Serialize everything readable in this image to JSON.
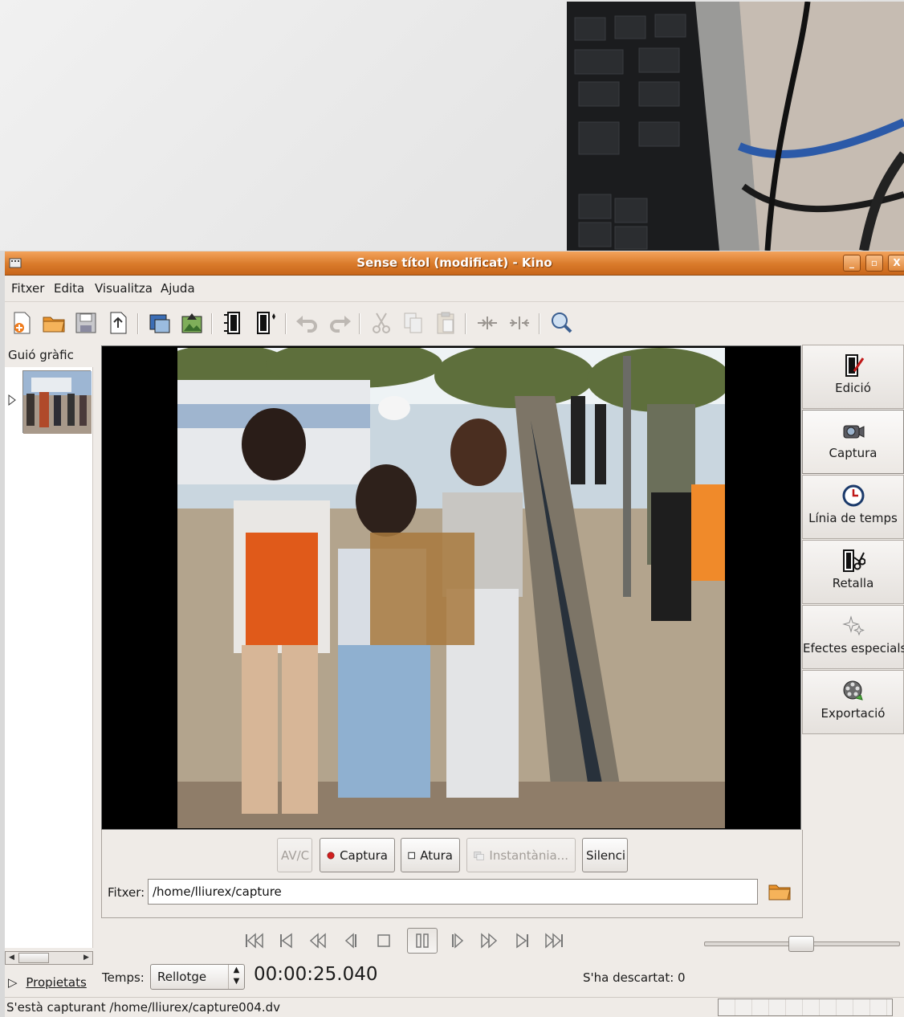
{
  "window": {
    "title": "Sense títol (modificat)  - Kino",
    "buttons": {
      "minimize": "_",
      "maximize": "▫",
      "close": "X"
    }
  },
  "menu": {
    "items": [
      {
        "label": "Fitxer"
      },
      {
        "label": "Edita"
      },
      {
        "label": "Visualitza"
      },
      {
        "label": "Ajuda"
      }
    ]
  },
  "toolbar": {
    "icons": [
      "new-document-icon",
      "open-folder-icon",
      "save-icon",
      "export-file-icon",
      "capture-frame-icon",
      "publish-icon",
      "insert-before-icon",
      "insert-after-icon",
      "undo-icon",
      "redo-icon",
      "cut-icon",
      "copy-icon",
      "paste-icon",
      "split-icon",
      "join-icon",
      "zoom-icon"
    ]
  },
  "storyboard": {
    "header": "Guió gràfic"
  },
  "properties": {
    "label": "Propietats"
  },
  "capture": {
    "avc_label": "AV/C",
    "capture_label": "Captura",
    "stop_label": "Atura",
    "snapshot_label": "Instantània...",
    "mute_label": "Silenci",
    "file_label": "Fitxer:",
    "file_value": "/home/lliurex/capture"
  },
  "sidebar": {
    "items": [
      {
        "label": "Edició",
        "icon": "edit-icon"
      },
      {
        "label": "Captura",
        "icon": "camera-icon"
      },
      {
        "label": "Línia de temps",
        "icon": "clock-icon"
      },
      {
        "label": "Retalla",
        "icon": "trim-icon"
      },
      {
        "label": "Efectes especials",
        "icon": "sparkle-icon"
      },
      {
        "label": "Exportació",
        "icon": "film-reel-icon"
      }
    ]
  },
  "transport": {
    "icons": [
      "skip-start-icon",
      "previous-scene-icon",
      "rewind-icon",
      "previous-frame-icon",
      "stop-icon",
      "pause-icon",
      "next-frame-icon",
      "fast-forward-icon",
      "next-scene-icon",
      "skip-end-icon"
    ]
  },
  "timebar": {
    "temps_label": "Temps:",
    "format": "Rellotge",
    "timecode": "00:00:25.040",
    "dropped": "S'ha descartat: 0"
  },
  "status": {
    "text": "S'està capturant /home/lliurex/capture004.dv"
  },
  "colors": {
    "titlebar": "#d97a2a",
    "window_bg": "#efebe7",
    "record_red": "#d11f1f"
  }
}
